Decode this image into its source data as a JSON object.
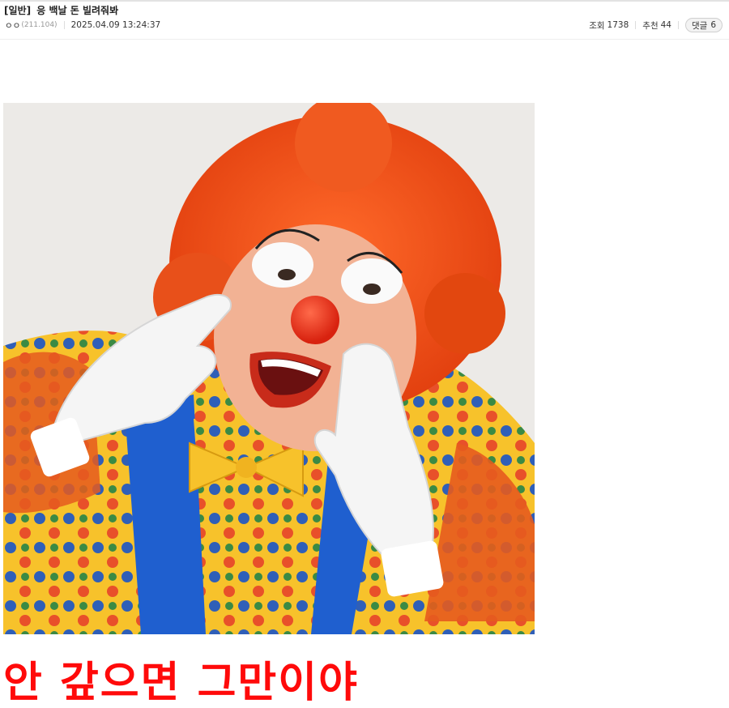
{
  "post": {
    "category": "[일반]",
    "title": "응 백날 돈 빌려줘봐",
    "author_nick": "ㅇㅇ",
    "author_ip": "(211.104)",
    "datetime": "2025.04.09 13:24:37",
    "views_label": "조회",
    "views": "1738",
    "recommend_label": "추천",
    "recommend": "44",
    "comments_label": "댓글",
    "comments": "6"
  },
  "content": {
    "image_icon": "clown-photo",
    "caption": "안 갚으면 그만이야",
    "caption_color": "#ff0a0a"
  }
}
